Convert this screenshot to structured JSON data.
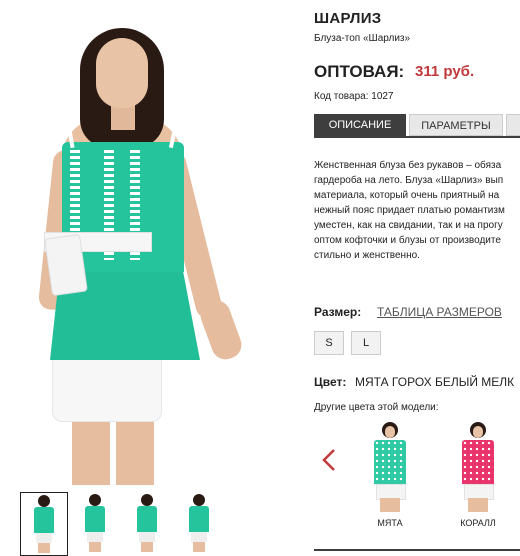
{
  "product": {
    "title": "ШАРЛИЗ",
    "subtitle": "Блуза-топ «Шарлиз»",
    "price_label": "ОПТОВАЯ:",
    "price_value": "311 руб.",
    "code": "Код товара: 1027"
  },
  "tabs": [
    {
      "label": "ОПИСАНИЕ",
      "active": true
    },
    {
      "label": "ПАРАМЕТРЫ",
      "active": false
    }
  ],
  "description_lines": [
    "Женственная блуза без рукавов – обяза",
    "гардероба на лето. Блуза «Шарлиз» вып",
    "материала, который очень приятный на",
    "нежный пояс придает платью романтизм",
    "уместен, как на свидании, так и на прогу",
    "оптом кофточки и блузы от производите",
    "стильно и женственно."
  ],
  "size": {
    "label": "Размер:",
    "table_link": "ТАБЛИЦА РАЗМЕРОВ",
    "options": [
      "S",
      "L"
    ]
  },
  "color": {
    "label": "Цвет:",
    "value": "МЯТА ГОРОХ БЕЛЫЙ МЕЛК",
    "other_label": "Другие цвета этой модели:",
    "variants": [
      {
        "name": "МЯТА",
        "color": "#2fc9a3"
      },
      {
        "name": "КОРАЛЛ",
        "color": "#e8336b"
      }
    ]
  },
  "colors": {
    "accent": "#c0393b",
    "tab_active": "#3e3e3e",
    "garment": "#25c49d"
  }
}
